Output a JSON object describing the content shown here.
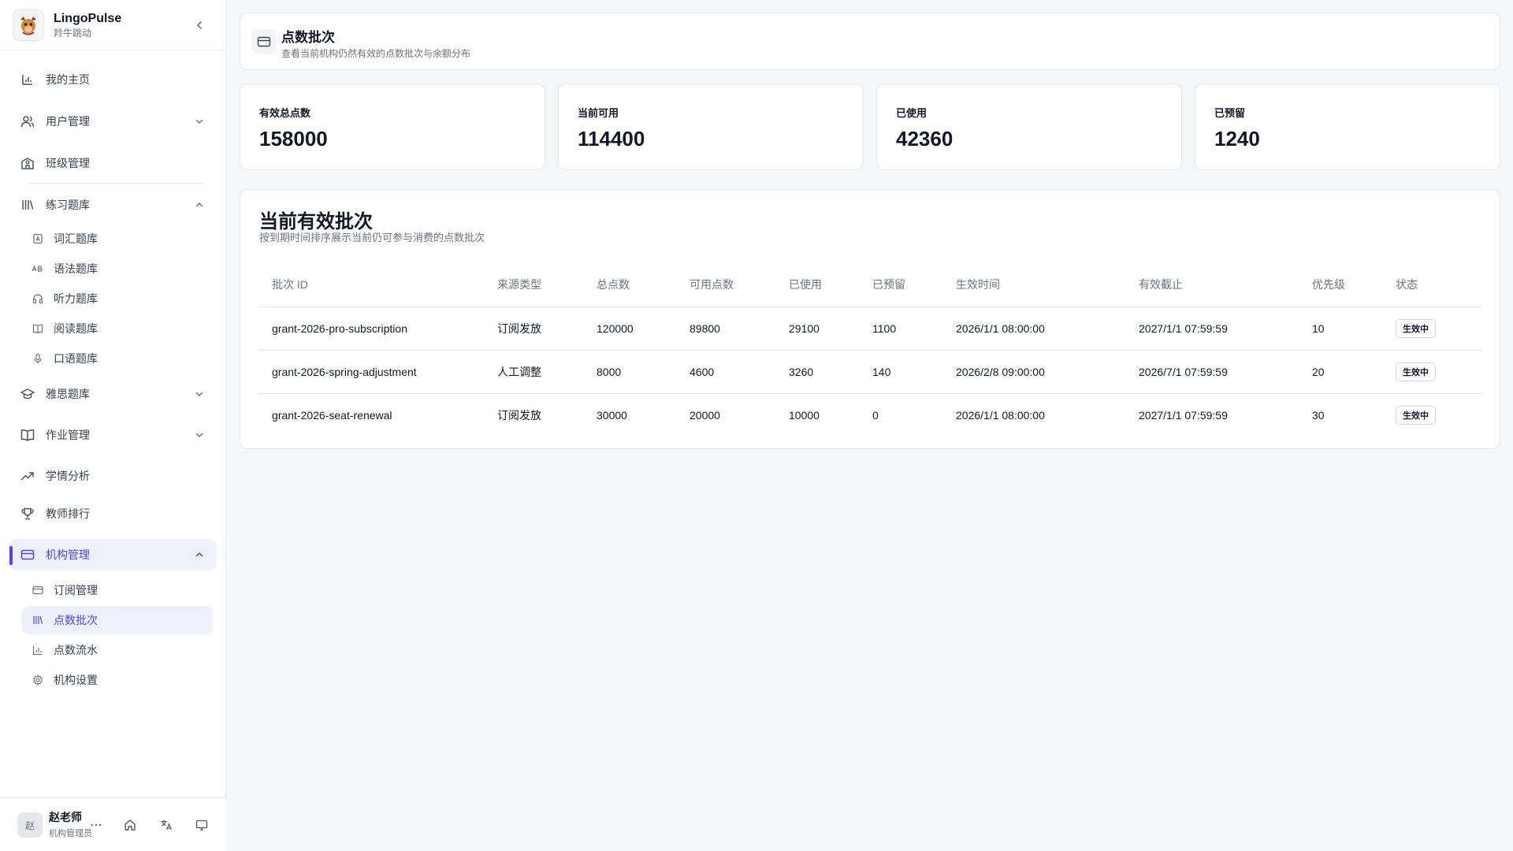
{
  "brand": {
    "name": "LingoPulse",
    "subtitle": "羚牛跳动"
  },
  "sidebar": {
    "items": [
      {
        "label": "我的主页",
        "icon": "bar-chart-icon"
      },
      {
        "label": "用户管理",
        "icon": "users-icon",
        "expanded": false
      },
      {
        "label": "班级管理",
        "icon": "school-icon"
      },
      {
        "label": "练习题库",
        "icon": "library-icon",
        "expanded": true
      },
      {
        "label": "雅思题库",
        "icon": "graduation-cap-icon",
        "expanded": false
      },
      {
        "label": "作业管理",
        "icon": "book-open-icon",
        "expanded": false
      },
      {
        "label": "学情分析",
        "icon": "trending-up-icon"
      },
      {
        "label": "教师排行",
        "icon": "trophy-icon"
      },
      {
        "label": "机构管理",
        "icon": "credit-card-icon",
        "expanded": true,
        "active": true
      }
    ],
    "practice_sub": [
      {
        "label": "词汇题库",
        "icon": "vocabulary-icon"
      },
      {
        "label": "语法题库",
        "icon": "grammar-icon"
      },
      {
        "label": "听力题库",
        "icon": "headphones-icon"
      },
      {
        "label": "阅读题库",
        "icon": "book-icon"
      },
      {
        "label": "口语题库",
        "icon": "mic-icon"
      }
    ],
    "org_sub": [
      {
        "label": "订阅管理",
        "icon": "credit-card-icon"
      },
      {
        "label": "点数批次",
        "icon": "library-icon",
        "active": true
      },
      {
        "label": "点数流水",
        "icon": "bar-chart-icon"
      },
      {
        "label": "机构设置",
        "icon": "gear-icon"
      }
    ]
  },
  "user": {
    "avatar": "赵",
    "name": "赵老师",
    "role": "机构管理员",
    "more": "⋯"
  },
  "page": {
    "title": "点数批次",
    "subtitle": "查看当前机构仍然有效的点数批次与余额分布"
  },
  "stats": [
    {
      "label": "有效总点数",
      "value": "158000"
    },
    {
      "label": "当前可用",
      "value": "114400"
    },
    {
      "label": "已使用",
      "value": "42360"
    },
    {
      "label": "已预留",
      "value": "1240"
    }
  ],
  "table": {
    "title": "当前有效批次",
    "subtitle": "按到期时间排序展示当前仍可参与消费的点数批次",
    "headers": [
      "批次 ID",
      "来源类型",
      "总点数",
      "可用点数",
      "已使用",
      "已预留",
      "生效时间",
      "有效截止",
      "优先级",
      "状态"
    ],
    "rows": [
      [
        "grant-2026-pro-subscription",
        "订阅发放",
        "120000",
        "89800",
        "29100",
        "1100",
        "2026/1/1 08:00:00",
        "2027/1/1 07:59:59",
        "10",
        "生效中"
      ],
      [
        "grant-2026-spring-adjustment",
        "人工调整",
        "8000",
        "4600",
        "3260",
        "140",
        "2026/2/8 09:00:00",
        "2026/7/1 07:59:59",
        "20",
        "生效中"
      ],
      [
        "grant-2026-seat-renewal",
        "订阅发放",
        "30000",
        "20000",
        "10000",
        "0",
        "2026/1/1 08:00:00",
        "2027/1/1 07:59:59",
        "30",
        "生效中"
      ]
    ]
  },
  "colors": {
    "accent": "#4f46e5",
    "active_bg": "#eef0fb",
    "page_bg": "#f4f6f8"
  }
}
